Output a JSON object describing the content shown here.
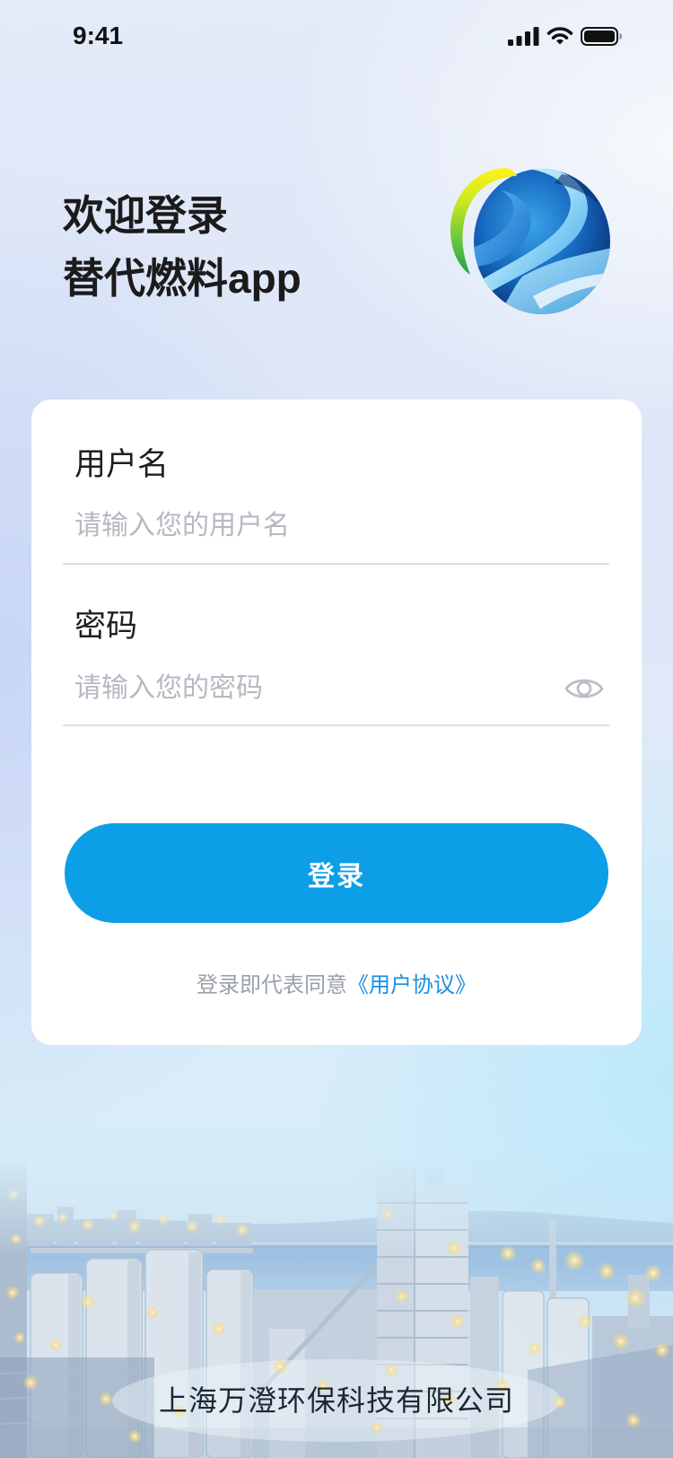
{
  "status_bar": {
    "time": "9:41",
    "icons": [
      "cellular-signal-icon",
      "wifi-icon",
      "battery-icon"
    ]
  },
  "header": {
    "title_line1": "欢迎登录",
    "title_line2": "替代燃料app",
    "logo": "company-logo-icon"
  },
  "form": {
    "username": {
      "label": "用户名",
      "placeholder": "请输入您的用户名",
      "value": ""
    },
    "password": {
      "label": "密码",
      "placeholder": "请输入您的密码",
      "value": "",
      "visibility_icon": "eye-icon"
    },
    "submit_label": "登录",
    "agreement": {
      "prefix": "登录即代表同意",
      "link": "《用户协议》"
    }
  },
  "footer": {
    "company": "上海万澄环保科技有限公司"
  },
  "colors": {
    "primary": "#0c9ee6",
    "link": "#1b8fe0",
    "title": "#1b1b1b",
    "placeholder": "#b5b9c0"
  }
}
